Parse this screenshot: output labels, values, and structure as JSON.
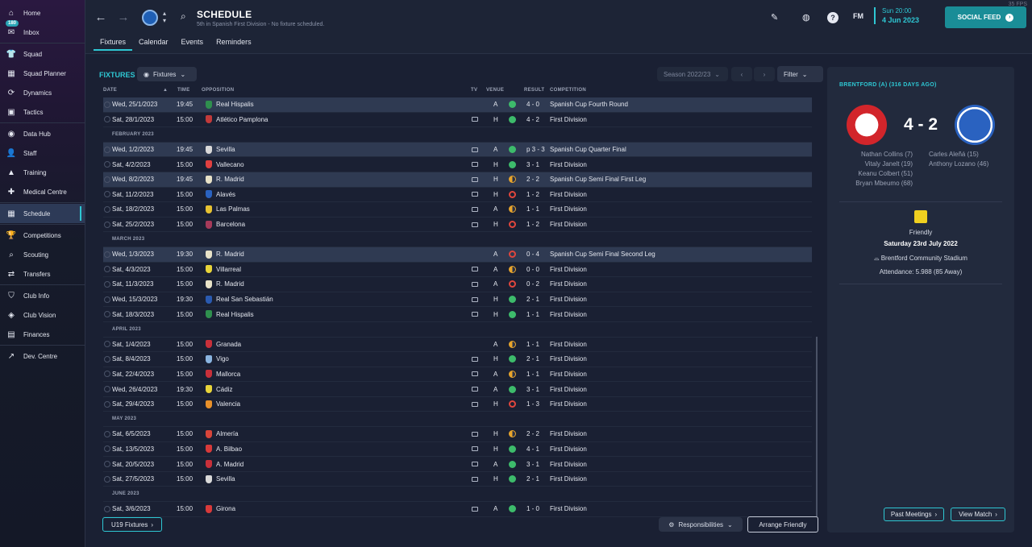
{
  "fps": "35 FPS",
  "sidebar": {
    "inbox_badge": "180",
    "items": [
      {
        "label": "Home",
        "icon": "home-icon",
        "glyph": "⌂"
      },
      {
        "label": "Inbox",
        "icon": "inbox-icon",
        "glyph": "✉"
      },
      {
        "label": "Squad",
        "icon": "shirt-icon",
        "glyph": "👕"
      },
      {
        "label": "Squad Planner",
        "icon": "planner-icon",
        "glyph": "▦"
      },
      {
        "label": "Dynamics",
        "icon": "dynamics-icon",
        "glyph": "⟳"
      },
      {
        "label": "Tactics",
        "icon": "tactics-icon",
        "glyph": "▣"
      },
      {
        "label": "Data Hub",
        "icon": "data-hub-icon",
        "glyph": "◉"
      },
      {
        "label": "Staff",
        "icon": "staff-icon",
        "glyph": "👤"
      },
      {
        "label": "Training",
        "icon": "training-icon",
        "glyph": "▲"
      },
      {
        "label": "Medical Centre",
        "icon": "medical-icon",
        "glyph": "✚"
      },
      {
        "label": "Schedule",
        "icon": "calendar-icon",
        "glyph": "▦"
      },
      {
        "label": "Competitions",
        "icon": "trophy-icon",
        "glyph": "🏆"
      },
      {
        "label": "Scouting",
        "icon": "scouting-icon",
        "glyph": "⌕"
      },
      {
        "label": "Transfers",
        "icon": "transfers-icon",
        "glyph": "⇄"
      },
      {
        "label": "Club Info",
        "icon": "shield-icon",
        "glyph": "⛉"
      },
      {
        "label": "Club Vision",
        "icon": "vision-icon",
        "glyph": "◈"
      },
      {
        "label": "Finances",
        "icon": "finances-icon",
        "glyph": "▤"
      },
      {
        "label": "Dev. Centre",
        "icon": "dev-centre-icon",
        "glyph": "↗"
      }
    ]
  },
  "header": {
    "title": "SCHEDULE",
    "subtitle": "5th in Spanish First Division - No fixture scheduled.",
    "tabs": [
      "Fixtures",
      "Calendar",
      "Events",
      "Reminders"
    ],
    "date_time": "Sun 20:00",
    "date": "4 Jun 2023",
    "social_feed": "SOCIAL FEED",
    "fm_label": "FM"
  },
  "fixtures": {
    "section_title": "FIXTURES",
    "view_selector": "Fixtures",
    "season": "Season 2022/23",
    "filter": "Filter",
    "columns": {
      "date": "DATE",
      "time": "TIME",
      "opposition": "OPPOSITION",
      "tv": "TV",
      "venue": "VENUE",
      "result": "RESULT",
      "competition": "COMPETITION"
    },
    "groups": [
      {
        "month": "",
        "rows": [
          {
            "date": "Wed, 25/1/2023",
            "time": "19:45",
            "opp": "Real Hispalis",
            "crest": "#2f8f4e",
            "tv": false,
            "venue": "A",
            "outcome": "w",
            "res": "4 - 0",
            "comp": "Spanish Cup Fourth Round",
            "hl": true
          },
          {
            "date": "Sat, 28/1/2023",
            "time": "15:00",
            "opp": "Atlético Pamplona",
            "crest": "#c23a3a",
            "tv": true,
            "venue": "H",
            "outcome": "w",
            "res": "4 - 2",
            "comp": "First Division",
            "hl": false
          }
        ]
      },
      {
        "month": "FEBRUARY 2023",
        "rows": [
          {
            "date": "Wed, 1/2/2023",
            "time": "19:45",
            "opp": "Sevilla",
            "crest": "#d9d9d9",
            "tv": true,
            "venue": "A",
            "outcome": "w",
            "res": "p 3 - 3",
            "comp": "Spanish Cup Quarter Final",
            "hl": true
          },
          {
            "date": "Sat, 4/2/2023",
            "time": "15:00",
            "opp": "Vallecano",
            "crest": "#e04040",
            "tv": true,
            "venue": "H",
            "outcome": "w",
            "res": "3 - 1",
            "comp": "First Division",
            "hl": false
          },
          {
            "date": "Wed, 8/2/2023",
            "time": "19:45",
            "opp": "R. Madrid",
            "crest": "#e8e2c8",
            "tv": true,
            "venue": "H",
            "outcome": "d",
            "res": "2 - 2",
            "comp": "Spanish Cup Semi Final First Leg",
            "hl": true
          },
          {
            "date": "Sat, 11/2/2023",
            "time": "15:00",
            "opp": "Alavés",
            "crest": "#2a62c0",
            "tv": true,
            "venue": "H",
            "outcome": "l",
            "res": "1 - 2",
            "comp": "First Division",
            "hl": false
          },
          {
            "date": "Sat, 18/2/2023",
            "time": "15:00",
            "opp": "Las Palmas",
            "crest": "#e6c232",
            "tv": true,
            "venue": "A",
            "outcome": "d",
            "res": "1 - 1",
            "comp": "First Division",
            "hl": false
          },
          {
            "date": "Sat, 25/2/2023",
            "time": "15:00",
            "opp": "Barcelona",
            "crest": "#a63a5a",
            "tv": true,
            "venue": "H",
            "outcome": "l",
            "res": "1 - 2",
            "comp": "First Division",
            "hl": false
          }
        ]
      },
      {
        "month": "MARCH 2023",
        "rows": [
          {
            "date": "Wed, 1/3/2023",
            "time": "19:30",
            "opp": "R. Madrid",
            "crest": "#e8e2c8",
            "tv": false,
            "venue": "A",
            "outcome": "l",
            "res": "0 - 4",
            "comp": "Spanish Cup Semi Final Second Leg",
            "hl": true
          },
          {
            "date": "Sat, 4/3/2023",
            "time": "15:00",
            "opp": "Villarreal",
            "crest": "#e8d43a",
            "tv": true,
            "venue": "A",
            "outcome": "d",
            "res": "0 - 0",
            "comp": "First Division",
            "hl": false
          },
          {
            "date": "Sat, 11/3/2023",
            "time": "15:00",
            "opp": "R. Madrid",
            "crest": "#e8e2c8",
            "tv": true,
            "venue": "A",
            "outcome": "l",
            "res": "0 - 2",
            "comp": "First Division",
            "hl": false
          },
          {
            "date": "Wed, 15/3/2023",
            "time": "19:30",
            "opp": "Real San Sebastián",
            "crest": "#2a5ab0",
            "tv": true,
            "venue": "H",
            "outcome": "w",
            "res": "2 - 1",
            "comp": "First Division",
            "hl": false
          },
          {
            "date": "Sat, 18/3/2023",
            "time": "15:00",
            "opp": "Real Hispalis",
            "crest": "#2f8f4e",
            "tv": true,
            "venue": "H",
            "outcome": "w",
            "res": "1 - 1",
            "comp": "First Division",
            "hl": false
          }
        ]
      },
      {
        "month": "APRIL 2023",
        "rows": [
          {
            "date": "Sat, 1/4/2023",
            "time": "15:00",
            "opp": "Granada",
            "crest": "#c8303a",
            "tv": false,
            "venue": "A",
            "outcome": "d",
            "res": "1 - 1",
            "comp": "First Division",
            "hl": false
          },
          {
            "date": "Sat, 8/4/2023",
            "time": "15:00",
            "opp": "Vigo",
            "crest": "#8ab4e0",
            "tv": true,
            "venue": "H",
            "outcome": "w",
            "res": "2 - 1",
            "comp": "First Division",
            "hl": false
          },
          {
            "date": "Sat, 22/4/2023",
            "time": "15:00",
            "opp": "Mallorca",
            "crest": "#c8303a",
            "tv": true,
            "venue": "A",
            "outcome": "d",
            "res": "1 - 1",
            "comp": "First Division",
            "hl": false
          },
          {
            "date": "Wed, 26/4/2023",
            "time": "19:30",
            "opp": "Cádiz",
            "crest": "#e8d43a",
            "tv": true,
            "venue": "A",
            "outcome": "w",
            "res": "3 - 1",
            "comp": "First Division",
            "hl": false
          },
          {
            "date": "Sat, 29/4/2023",
            "time": "15:00",
            "opp": "Valencia",
            "crest": "#e8902a",
            "tv": true,
            "venue": "H",
            "outcome": "l",
            "res": "1 - 3",
            "comp": "First Division",
            "hl": false
          }
        ]
      },
      {
        "month": "MAY 2023",
        "rows": [
          {
            "date": "Sat, 6/5/2023",
            "time": "15:00",
            "opp": "Almería",
            "crest": "#d8453a",
            "tv": true,
            "venue": "H",
            "outcome": "d",
            "res": "2 - 2",
            "comp": "First Division",
            "hl": false
          },
          {
            "date": "Sat, 13/5/2023",
            "time": "15:00",
            "opp": "A. Bilbao",
            "crest": "#d83a3a",
            "tv": true,
            "venue": "H",
            "outcome": "w",
            "res": "4 - 1",
            "comp": "First Division",
            "hl": false
          },
          {
            "date": "Sat, 20/5/2023",
            "time": "15:00",
            "opp": "A. Madrid",
            "crest": "#c8303a",
            "tv": true,
            "venue": "A",
            "outcome": "w",
            "res": "3 - 1",
            "comp": "First Division",
            "hl": false
          },
          {
            "date": "Sat, 27/5/2023",
            "time": "15:00",
            "opp": "Sevilla",
            "crest": "#d9d9d9",
            "tv": true,
            "venue": "H",
            "outcome": "w",
            "res": "2 - 1",
            "comp": "First Division",
            "hl": false
          }
        ]
      },
      {
        "month": "JUNE 2023",
        "rows": [
          {
            "date": "Sat, 3/6/2023",
            "time": "15:00",
            "opp": "Girona",
            "crest": "#d83a3a",
            "tv": true,
            "venue": "A",
            "outcome": "w",
            "res": "1 - 0",
            "comp": "First Division",
            "hl": false
          }
        ]
      }
    ],
    "u19_button": "U19 Fixtures",
    "responsibilities": "Responsibilities",
    "arrange_friendly": "Arrange Friendly"
  },
  "match_panel": {
    "title": "BRENTFORD (A) (316 DAYS AGO)",
    "score": "4 - 2",
    "home_scorers": [
      "Nathan Collins (7)",
      "Vitaly Janelt (19)",
      "Keanu Colbert (51)",
      "Bryan Mbeumo (68)"
    ],
    "away_scorers": [
      "Carles Aleñá (15)",
      "Anthony Lozano (46)"
    ],
    "competition": "Friendly",
    "match_date": "Saturday 23rd July 2022",
    "stadium": "Brentford Community Stadium",
    "attendance": "Attendance: 5.988 (85 Away)",
    "past_meetings": "Past Meetings",
    "view_match": "View Match"
  },
  "colors": {
    "accent": "#2ec7d3",
    "win": "#3dbb6b",
    "loss": "#e0463d",
    "draw": "#e8a52c"
  }
}
